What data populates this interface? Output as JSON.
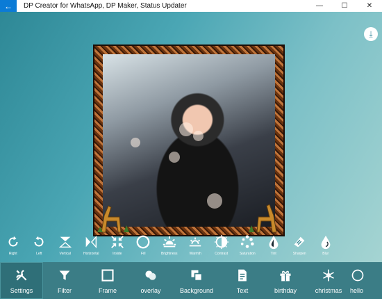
{
  "window": {
    "title": "DP Creator for WhatsApp, DP Maker, Status Updater",
    "back_icon": "back-arrow-icon",
    "minimize": "—",
    "maximize": "☐",
    "close": "✕"
  },
  "toolbar": {
    "items": [
      {
        "label": "Right",
        "icon": "rotate-right-icon"
      },
      {
        "label": "Left",
        "icon": "rotate-left-icon"
      },
      {
        "label": "Vertical",
        "icon": "flip-vertical-icon"
      },
      {
        "label": "Horizontal",
        "icon": "flip-horizontal-icon"
      },
      {
        "label": "Inside",
        "icon": "inside-icon"
      },
      {
        "label": "Fill",
        "icon": "fill-icon"
      },
      {
        "label": "Brightness",
        "icon": "brightness-icon"
      },
      {
        "label": "Warmth",
        "icon": "warmth-icon"
      },
      {
        "label": "Contrast",
        "icon": "contrast-icon"
      },
      {
        "label": "Saturation",
        "icon": "saturation-icon"
      },
      {
        "label": "Tint",
        "icon": "tint-icon"
      },
      {
        "label": "Sharpen",
        "icon": "sharpen-icon"
      },
      {
        "label": "Blur",
        "icon": "blur-icon"
      }
    ]
  },
  "tabs": [
    {
      "label": "Settings",
      "icon": "settings-tools-icon"
    },
    {
      "label": "Filter",
      "icon": "filter-icon"
    },
    {
      "label": "Frame",
      "icon": "frame-icon"
    },
    {
      "label": "overlay",
      "icon": "overlay-icon"
    },
    {
      "label": "Background",
      "icon": "background-icon"
    },
    {
      "label": "Text",
      "icon": "text-icon"
    },
    {
      "label": "birthday",
      "icon": "gift-icon"
    },
    {
      "label": "christmas",
      "icon": "snowflake-icon"
    },
    {
      "label": "hello",
      "icon": "hello-icon"
    }
  ],
  "colors": {
    "accent": "#0b7bd6",
    "bar": "#3b7d86"
  }
}
